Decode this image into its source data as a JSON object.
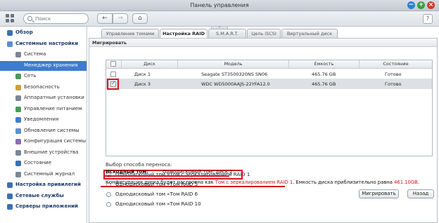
{
  "window": {
    "title": "Панель управления"
  },
  "search": {
    "placeholder": "Поиск"
  },
  "icons": {
    "grid": "grid-icon",
    "search": "search-icon",
    "back": "arrow-left-icon",
    "forward": "arrow-right-icon",
    "home": "home-icon",
    "help": "help-icon",
    "minimize": "minimize-icon",
    "maximize": "maximize-icon",
    "close": "close-icon",
    "fold": "chevron-up-icon"
  },
  "nav_glyphs": {
    "back": "←",
    "forward": "→",
    "home": "⌂",
    "help": "?",
    "min": "−",
    "max": "+",
    "close": "×",
    "fold": "⌃"
  },
  "sidebar": {
    "items": [
      {
        "label": "Обзор",
        "icon": "overview-icon",
        "level": "top",
        "selected": false
      },
      {
        "label": "Системные настройки",
        "icon": "settings-icon",
        "level": "top",
        "selected": false
      },
      {
        "label": "Система",
        "icon": "system-icon",
        "level": "sub",
        "selected": false
      },
      {
        "label": "Менеджер хранения",
        "icon": "storage-icon",
        "level": "sub",
        "selected": true
      },
      {
        "label": "Сеть",
        "icon": "network-icon",
        "level": "sub",
        "selected": false
      },
      {
        "label": "Безопасность",
        "icon": "security-icon",
        "level": "sub",
        "selected": false
      },
      {
        "label": "Аппаратные установки",
        "icon": "hardware-icon",
        "level": "sub",
        "selected": false
      },
      {
        "label": "Управление питанием",
        "icon": "power-icon",
        "level": "sub",
        "selected": false
      },
      {
        "label": "Уведомления",
        "icon": "notification-icon",
        "level": "sub",
        "selected": false
      },
      {
        "label": "Обновление системы",
        "icon": "update-icon",
        "level": "sub",
        "selected": false
      },
      {
        "label": "Конфигурация системы",
        "icon": "config-icon",
        "level": "sub",
        "selected": false
      },
      {
        "label": "Внешние устройства",
        "icon": "external-device-icon",
        "level": "sub",
        "selected": false
      },
      {
        "label": "Состояние",
        "icon": "status-icon",
        "level": "sub",
        "selected": false
      },
      {
        "label": "Системный журнал",
        "icon": "log-icon",
        "level": "sub",
        "selected": false
      },
      {
        "label": "Настройка привилегий",
        "icon": "privilege-icon",
        "level": "top",
        "selected": false
      },
      {
        "label": "Сетевые службы",
        "icon": "network-services-icon",
        "level": "top",
        "selected": false
      },
      {
        "label": "Серверы приложений",
        "icon": "app-servers-icon",
        "level": "top",
        "selected": false
      }
    ]
  },
  "tabs": [
    {
      "label": "Управление томами",
      "active": false
    },
    {
      "label": "Настройка RAID",
      "active": true
    },
    {
      "label": "S.M.A.R.T.",
      "active": false
    },
    {
      "label": "Цель iSCSI",
      "active": false
    },
    {
      "label": "Виртуальный диск",
      "active": false
    }
  ],
  "panel": {
    "title": "Мигрировать"
  },
  "disk_table": {
    "headers": [
      "",
      "Диск",
      "Модель",
      "Емкость",
      "Состояние"
    ],
    "rows": [
      {
        "checked": false,
        "disk": "Диск 1",
        "model": "Seagate ST3500320NS SN06",
        "capacity": "465.76 GB",
        "status": "Готово",
        "selected": false
      },
      {
        "checked": true,
        "disk": "Диск 3",
        "model": "WDC WD5000AAJS-22YFA12.0",
        "capacity": "465.76 GB",
        "status": "Готово",
        "selected": true
      }
    ]
  },
  "migration": {
    "title": "Выбор способа переноса:",
    "options": [
      {
        "label": "Однодисковый том »Том с зеркалированием RAID 1",
        "selected": true
      },
      {
        "label": "Однодисковый том »Том RAID 5",
        "selected": false
      },
      {
        "label": "Однодисковый том »Том RAID 6",
        "selected": false
      },
      {
        "label": "Однодисковый том »Том RAID 10",
        "selected": false
      }
    ]
  },
  "source": {
    "label": "Исходный том:",
    "value": "Однодисковый том: диск 2"
  },
  "summary": {
    "part1": "Конфигурация диска будет настроена как ",
    "raid": "Том с зеркалированием RAID 1",
    "part2": ". Емкость диска приблизительно равна ",
    "size": "461.10GB",
    "part3": "."
  },
  "buttons": {
    "migrate": "Мигрировать",
    "back": "Назад"
  },
  "colors": {
    "accent": "#3d7ccf",
    "highlight": "#d5161b"
  }
}
